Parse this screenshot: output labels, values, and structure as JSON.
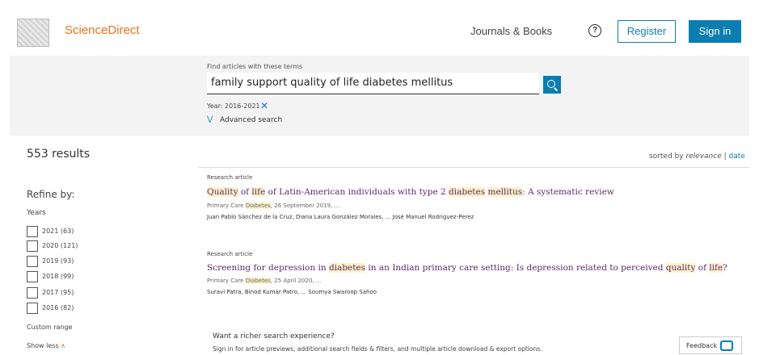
{
  "header": {
    "brand": "ScienceDirect",
    "journals_books": "Journals & Books",
    "help_symbol": "?",
    "register": "Register",
    "sign_in": "Sign in"
  },
  "search": {
    "label": "Find articles with these terms",
    "query": "family support quality of life diabetes mellitus",
    "year_filter": "Year: 2016-2021",
    "remove_symbol": "✕",
    "advanced": "Advanced search"
  },
  "results": {
    "count": "553 results",
    "sorted_prefix": "sorted by ",
    "sort_relevance": "relevance",
    "sort_sep": " | ",
    "sort_date": "date"
  },
  "refine": {
    "title": "Refine by:",
    "years_label": "Years",
    "years": [
      {
        "label": "2021 (63)"
      },
      {
        "label": "2020 (121)"
      },
      {
        "label": "2019 (93)"
      },
      {
        "label": "2018 (99)"
      },
      {
        "label": "2017 (95)"
      },
      {
        "label": "2016 (82)"
      }
    ],
    "custom_range": "Custom range",
    "show_less": "Show less"
  },
  "articles": [
    {
      "type": "Research article",
      "title_parts": [
        "Quality",
        " of ",
        "life",
        " of Latin-American individuals with type 2 ",
        "diabetes",
        " ",
        "mellitus",
        ": A systematic review"
      ],
      "journal_name": "Primary Care ",
      "journal_hl": "Diabetes",
      "journal_rest": ", 26 September 2019, ...",
      "authors": "Juan Pablo Sánchez de la Cruz, Diana Laura González Morales, ... José Manuel Rodriguez-Perez"
    },
    {
      "type": "Research article",
      "title_parts": [
        "Screening for depression in ",
        "diabetes",
        " in an Indian primary care setting: Is depression related to perceived ",
        "quality",
        " of ",
        "life",
        "?"
      ],
      "journal_name": "Primary Care ",
      "journal_hl": "Diabetes",
      "journal_rest": ", 25 April 2020, ...",
      "authors": "Suravi Patra, Binod Kumar Patro, ... Soumya Swaroop Sahoo"
    }
  ],
  "promo": {
    "title": "Want a richer search experience?",
    "body": "Sign in for article previews, additional search fields & filters, and multiple article download & export options."
  },
  "feedback": "Feedback",
  "colors": {
    "accent": "#0c7db1",
    "brand": "#e9711c",
    "title_link": "#5a2a6e",
    "highlight": "#fdf1c8"
  },
  "icons": [
    "elsevier-logo",
    "help-icon",
    "search-icon",
    "close-icon",
    "chevron-down-icon",
    "chevron-up-icon",
    "feedback-icon"
  ]
}
